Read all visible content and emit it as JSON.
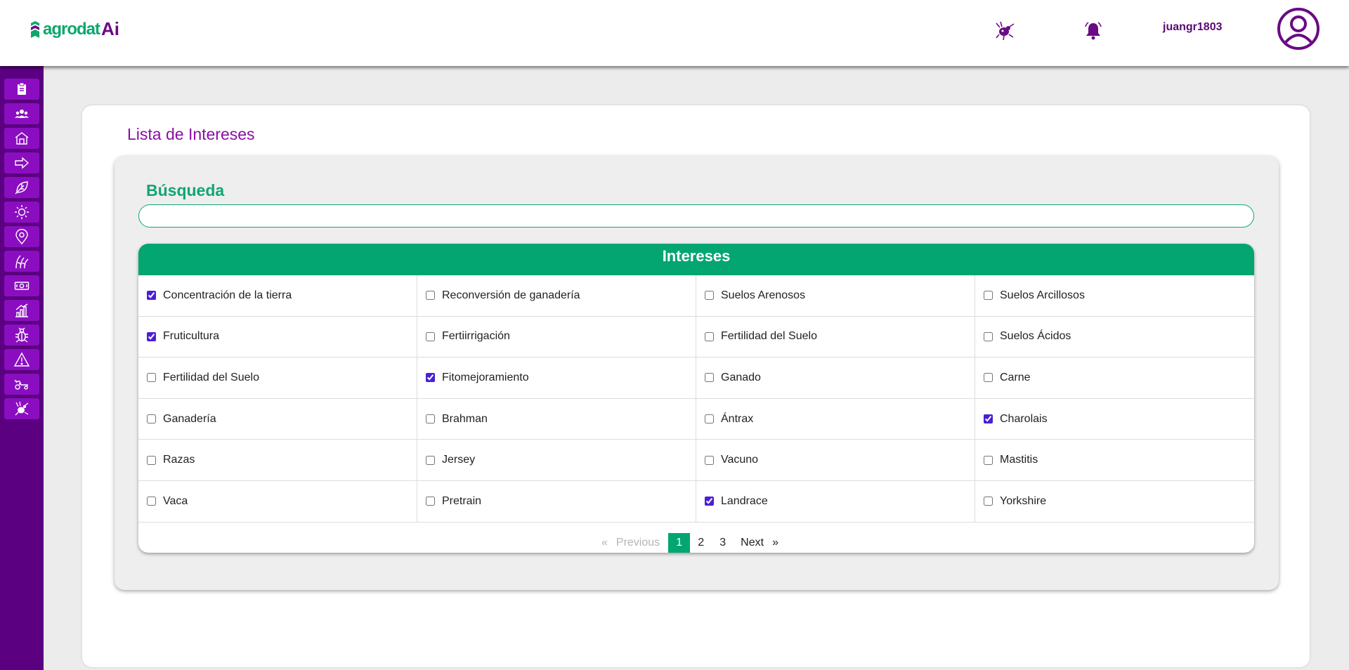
{
  "app": {
    "logo_text": "agrodat",
    "logo_ai": "Ai",
    "username": "juangr1803"
  },
  "colors": {
    "brand_purple": "#5b0080",
    "sidebar_button": "#8a0ec0",
    "accent_green": "#03a571",
    "title_purple": "#8a0ea6"
  },
  "header_icons": [
    "mosquito-alert-icon",
    "bell-icon",
    "user-avatar-icon"
  ],
  "sidebar": {
    "items": [
      {
        "icon": "clipboard-icon"
      },
      {
        "icon": "users-group-icon"
      },
      {
        "icon": "farm-house-icon"
      },
      {
        "icon": "arrow-right-icon"
      },
      {
        "icon": "leaf-icon"
      },
      {
        "icon": "sun-icon"
      },
      {
        "icon": "location-pin-icon"
      },
      {
        "icon": "crop-plant-icon"
      },
      {
        "icon": "money-bill-icon"
      },
      {
        "icon": "bar-chart-icon"
      },
      {
        "icon": "bug-icon"
      },
      {
        "icon": "warning-icon"
      },
      {
        "icon": "tractor-icon"
      },
      {
        "icon": "mosquito-icon"
      }
    ]
  },
  "page": {
    "title": "Lista de Intereses",
    "search_label": "Búsqueda",
    "search_value": "",
    "table_header": "Intereses"
  },
  "interests": [
    {
      "label": "Concentración de la tierra",
      "checked": true
    },
    {
      "label": "Reconversión de ganadería",
      "checked": false
    },
    {
      "label": "Suelos Arenosos",
      "checked": false
    },
    {
      "label": "Suelos Arcillosos",
      "checked": false
    },
    {
      "label": "Fruticultura",
      "checked": true
    },
    {
      "label": "Fertiirrigación",
      "checked": false
    },
    {
      "label": "Fertilidad del Suelo",
      "checked": false
    },
    {
      "label": "Suelos Ácidos",
      "checked": false
    },
    {
      "label": "Fertilidad del Suelo",
      "checked": false
    },
    {
      "label": "Fitomejoramiento",
      "checked": true
    },
    {
      "label": "Ganado",
      "checked": false
    },
    {
      "label": "Carne",
      "checked": false
    },
    {
      "label": "Ganadería",
      "checked": false
    },
    {
      "label": "Brahman",
      "checked": false
    },
    {
      "label": "Ántrax",
      "checked": false
    },
    {
      "label": "Charolais",
      "checked": true
    },
    {
      "label": "Razas",
      "checked": false
    },
    {
      "label": "Jersey",
      "checked": false
    },
    {
      "label": "Vacuno",
      "checked": false
    },
    {
      "label": "Mastitis",
      "checked": false
    },
    {
      "label": "Vaca",
      "checked": false
    },
    {
      "label": "Pretrain",
      "checked": false
    },
    {
      "label": "Landrace",
      "checked": true
    },
    {
      "label": "Yorkshire",
      "checked": false
    }
  ],
  "pagination": {
    "first": "«",
    "previous": "Previous",
    "pages": [
      "1",
      "2",
      "3"
    ],
    "current": "1",
    "next": "Next",
    "last": "»"
  }
}
